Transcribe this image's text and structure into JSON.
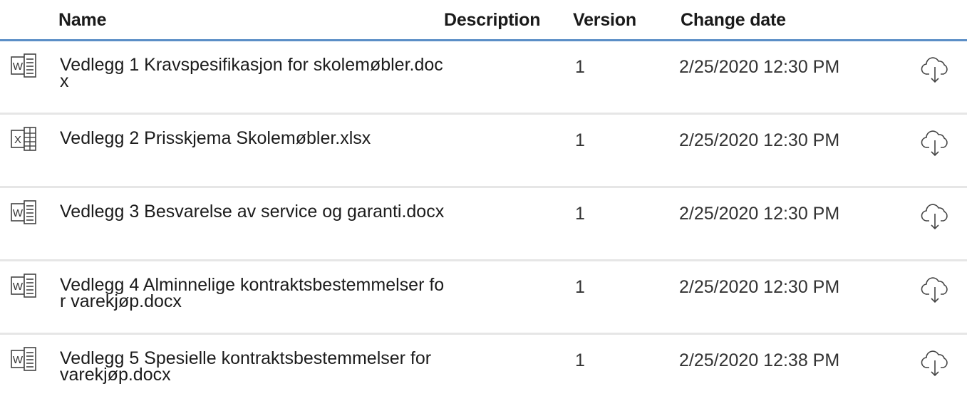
{
  "columns": {
    "name": "Name",
    "description": "Description",
    "version": "Version",
    "change_date": "Change date"
  },
  "rows": [
    {
      "icon": "word-document-icon",
      "name": "Vedlegg 1 Kravspesifikasjon for skolemøbler.docx",
      "description": "",
      "version": "1",
      "change_date": "2/25/2020 12:30 PM",
      "action_icon": "cloud-download-icon"
    },
    {
      "icon": "excel-spreadsheet-icon",
      "name": "Vedlegg 2 Prisskjema Skolemøbler.xlsx",
      "description": "",
      "version": "1",
      "change_date": "2/25/2020 12:30 PM",
      "action_icon": "cloud-download-icon"
    },
    {
      "icon": "word-document-icon",
      "name": "Vedlegg 3 Besvarelse av service og garanti.docx",
      "description": "",
      "version": "1",
      "change_date": "2/25/2020 12:30 PM",
      "action_icon": "cloud-download-icon"
    },
    {
      "icon": "word-document-icon",
      "name": "Vedlegg 4 Alminnelige kontraktsbestemmelser for varekjøp.docx",
      "description": "",
      "version": "1",
      "change_date": "2/25/2020 12:30 PM",
      "action_icon": "cloud-download-icon"
    },
    {
      "icon": "word-document-icon",
      "name": "Vedlegg 5 Spesielle kontraktsbestemmelser for varekjøp.docx",
      "description": "",
      "version": "1",
      "change_date": "2/25/2020 12:38 PM",
      "action_icon": "cloud-download-icon"
    }
  ]
}
